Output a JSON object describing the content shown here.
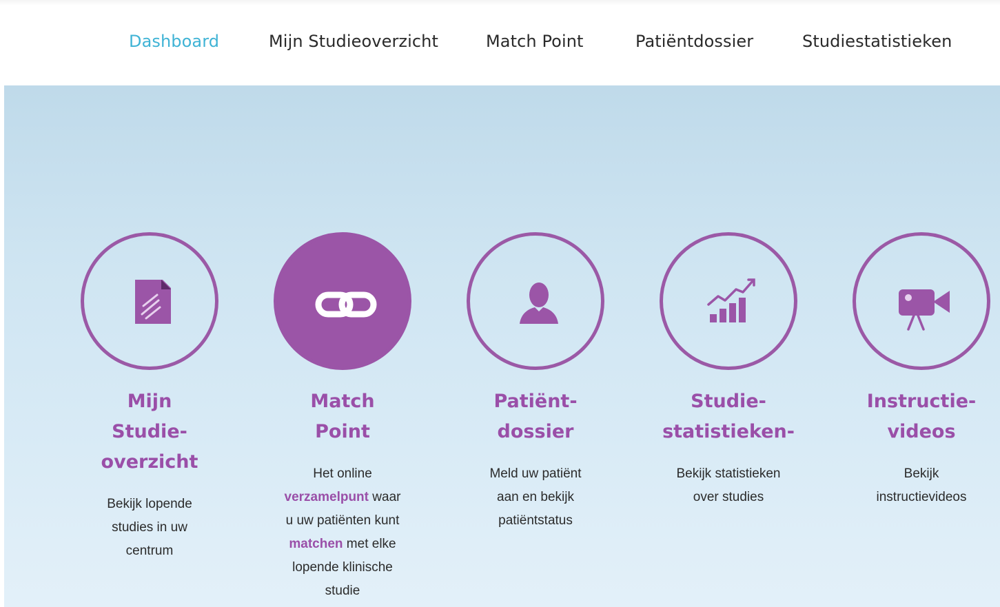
{
  "nav": {
    "items": [
      {
        "label": "Dashboard",
        "active": true
      },
      {
        "label": "Mijn Studieoverzicht",
        "active": false
      },
      {
        "label": "Match Point",
        "active": false
      },
      {
        "label": "Patiëntdossier",
        "active": false
      },
      {
        "label": "Studiestatistieken",
        "active": false
      }
    ]
  },
  "features": [
    {
      "icon": "document-icon",
      "title_lines": [
        "Mijn",
        "Studie-",
        "overzicht"
      ],
      "desc_lines": [
        "Bekijk lopende",
        "studies in uw",
        "centrum"
      ]
    },
    {
      "icon": "link-icon",
      "title_lines": [
        "Match",
        "Point"
      ],
      "desc": {
        "l1": "Het online",
        "l2_hl": "verzamelpunt",
        "l2_rest": " waar",
        "l3": "u uw patiënten kunt",
        "l4_hl": "matchen",
        "l4_rest": " met elke",
        "l5": "lopende klinische",
        "l6": "studie"
      }
    },
    {
      "icon": "user-icon",
      "title_lines": [
        "Patiënt-",
        "dossier"
      ],
      "desc_lines": [
        "Meld uw patiënt",
        "aan en bekijk",
        "patiëntstatus"
      ]
    },
    {
      "icon": "bar-chart-icon",
      "title_lines": [
        "Studie-",
        "statistieken-"
      ],
      "desc_lines": [
        "Bekijk statistieken",
        "over studies"
      ]
    },
    {
      "icon": "video-camera-icon",
      "title_lines": [
        "Instructie-",
        "videos"
      ],
      "desc_lines": [
        "Bekijk",
        "instructievideos"
      ]
    }
  ],
  "colors": {
    "accent_purple": "#9b59a6",
    "nav_active": "#3fb3d5",
    "hero_bg_top": "#bfdaea",
    "hero_bg_bottom": "#e3f0f9"
  }
}
